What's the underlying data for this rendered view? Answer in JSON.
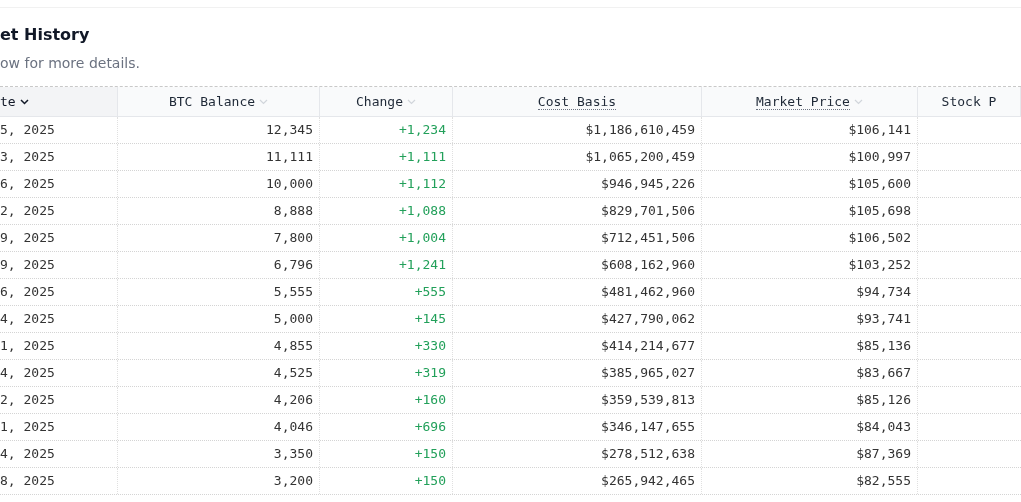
{
  "header": {
    "title": "et History",
    "subtitle": "ow for more details."
  },
  "table": {
    "columns": [
      {
        "label": "te",
        "sortable": true,
        "sorted": true,
        "underlined": false
      },
      {
        "label": "BTC Balance",
        "sortable": true,
        "sorted": false,
        "underlined": false
      },
      {
        "label": "Change",
        "sortable": true,
        "sorted": false,
        "underlined": false
      },
      {
        "label": "Cost Basis",
        "sortable": false,
        "sorted": false,
        "underlined": true
      },
      {
        "label": "Market Price",
        "sortable": true,
        "sorted": false,
        "underlined": true
      },
      {
        "label": "Stock P",
        "sortable": false,
        "sorted": false,
        "underlined": false
      }
    ],
    "rows": [
      {
        "date": "5, 2025",
        "balance": "12,345",
        "change": "+1,234",
        "cost_basis": "$1,186,610,459",
        "market_price": "$106,141"
      },
      {
        "date": "3, 2025",
        "balance": "11,111",
        "change": "+1,111",
        "cost_basis": "$1,065,200,459",
        "market_price": "$100,997"
      },
      {
        "date": "6, 2025",
        "balance": "10,000",
        "change": "+1,112",
        "cost_basis": "$946,945,226",
        "market_price": "$105,600"
      },
      {
        "date": "2, 2025",
        "balance": "8,888",
        "change": "+1,088",
        "cost_basis": "$829,701,506",
        "market_price": "$105,698"
      },
      {
        "date": "9, 2025",
        "balance": "7,800",
        "change": "+1,004",
        "cost_basis": "$712,451,506",
        "market_price": "$106,502"
      },
      {
        "date": "9, 2025",
        "balance": "6,796",
        "change": "+1,241",
        "cost_basis": "$608,162,960",
        "market_price": "$103,252"
      },
      {
        "date": "6, 2025",
        "balance": "5,555",
        "change": "+555",
        "cost_basis": "$481,462,960",
        "market_price": "$94,734"
      },
      {
        "date": "4, 2025",
        "balance": "5,000",
        "change": "+145",
        "cost_basis": "$427,790,062",
        "market_price": "$93,741"
      },
      {
        "date": "1, 2025",
        "balance": "4,855",
        "change": "+330",
        "cost_basis": "$414,214,677",
        "market_price": "$85,136"
      },
      {
        "date": "4, 2025",
        "balance": "4,525",
        "change": "+319",
        "cost_basis": "$385,965,027",
        "market_price": "$83,667"
      },
      {
        "date": "2, 2025",
        "balance": "4,206",
        "change": "+160",
        "cost_basis": "$359,539,813",
        "market_price": "$85,126"
      },
      {
        "date": "1, 2025",
        "balance": "4,046",
        "change": "+696",
        "cost_basis": "$346,147,655",
        "market_price": "$84,043"
      },
      {
        "date": "4, 2025",
        "balance": "3,350",
        "change": "+150",
        "cost_basis": "$278,512,638",
        "market_price": "$87,369"
      },
      {
        "date": "8, 2025",
        "balance": "3,200",
        "change": "+150",
        "cost_basis": "$265,942,465",
        "market_price": "$82,555"
      }
    ]
  }
}
